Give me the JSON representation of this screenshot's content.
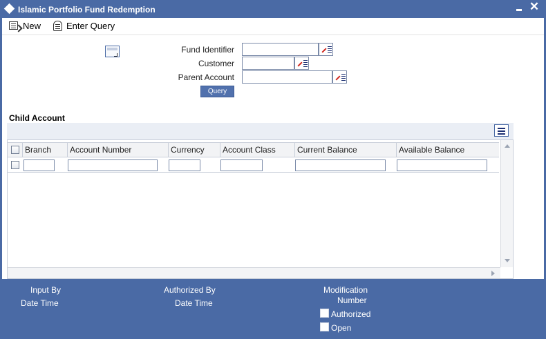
{
  "window": {
    "title": "Islamic Portfolio Fund Redemption",
    "minimize_icon": "minimize-icon",
    "close_glyph": "✕"
  },
  "toolbar": {
    "new_label": "New",
    "enter_query_label": "Enter Query"
  },
  "form": {
    "fund_identifier_label": "Fund Identifier",
    "fund_identifier_value": "",
    "customer_label": "Customer",
    "customer_value": "",
    "parent_account_label": "Parent Account",
    "parent_account_value": "",
    "query_button_label": "Query"
  },
  "child_account": {
    "section_title": "Child Account",
    "columns": [
      "Branch",
      "Account Number",
      "Currency",
      "Account Class",
      "Current Balance",
      "Available Balance"
    ],
    "rows": [
      {
        "selected": false,
        "branch": "",
        "account_number": "",
        "currency": "",
        "account_class": "",
        "current_balance": "",
        "available_balance": ""
      }
    ]
  },
  "footer": {
    "input_by_label": "Input By",
    "input_date_time_label": "Date Time",
    "authorized_by_label": "Authorized By",
    "authorized_date_time_label": "Date Time",
    "modification_label": "Modification",
    "number_label": "Number",
    "authorized_checkbox_label": "Authorized",
    "authorized_checked": false,
    "open_checkbox_label": "Open",
    "open_checked": false
  },
  "colors": {
    "frame_blue": "#4a6aa5",
    "button_blue": "#5171ad",
    "lov_red": "#d0261d"
  }
}
